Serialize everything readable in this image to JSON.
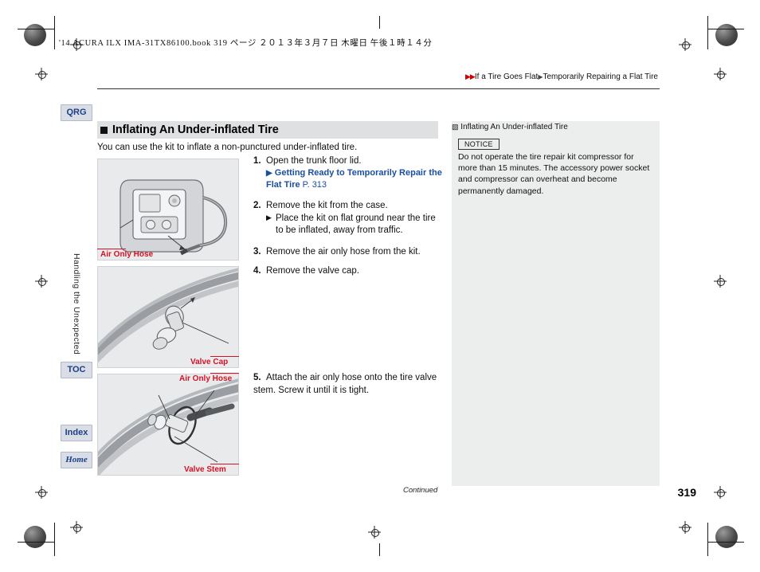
{
  "page": {
    "header_line": "'14 ACURA ILX IMA-31TX86100.book  319 ページ  ２０１３年３月７日  木曜日  午後１時１４分",
    "breadcrumb": {
      "arrows": "▶▶",
      "item1": "If a Tire Goes Flat",
      "separator": "▶",
      "item2": "Temporarily Repairing a Flat Tire"
    },
    "page_number": "319",
    "continued": "Continued"
  },
  "side_tabs": {
    "qrg": "QRG",
    "toc": "TOC",
    "index": "Index",
    "home": "Home",
    "vertical_label": "Handling the Unexpected"
  },
  "section": {
    "title": "Inflating An Under-inflated Tire",
    "intro": "You can use the kit to inflate a non-punctured under-inflated tire."
  },
  "steps": [
    {
      "num": "1.",
      "text": "Open the trunk floor lid.",
      "ref": {
        "icon": "▶",
        "label": "Getting Ready to Temporarily Repair the Flat Tire",
        "page": "P. 313"
      }
    },
    {
      "num": "2.",
      "text": "Remove the kit from the case.",
      "bullet": "Place the kit on flat ground near the tire to be inflated, away from traffic."
    },
    {
      "num": "3.",
      "text": "Remove the air only hose from the kit."
    },
    {
      "num": "4.",
      "text": "Remove the valve cap."
    }
  ],
  "step5": {
    "num": "5.",
    "text": "Attach the air only hose onto the tire valve stem. Screw it until it is tight."
  },
  "figures": [
    {
      "caption": "Air Only Hose"
    },
    {
      "caption": "Valve Cap"
    },
    {
      "caption": "Air Only Hose"
    },
    {
      "caption": "Valve Stem"
    }
  ],
  "sidebar": {
    "title_icon": "▧",
    "title": "Inflating An Under-inflated Tire",
    "notice_label": "NOTICE",
    "notice_text": "Do not operate the tire repair kit compressor for more than 15 minutes. The accessory power socket and compressor can overheat and become permanently damaged."
  },
  "colors": {
    "caption_red": "#d41226",
    "link_blue": "#1a4fa0",
    "tab_bg": "#d9dde6",
    "panel_bg": "#eceded"
  }
}
